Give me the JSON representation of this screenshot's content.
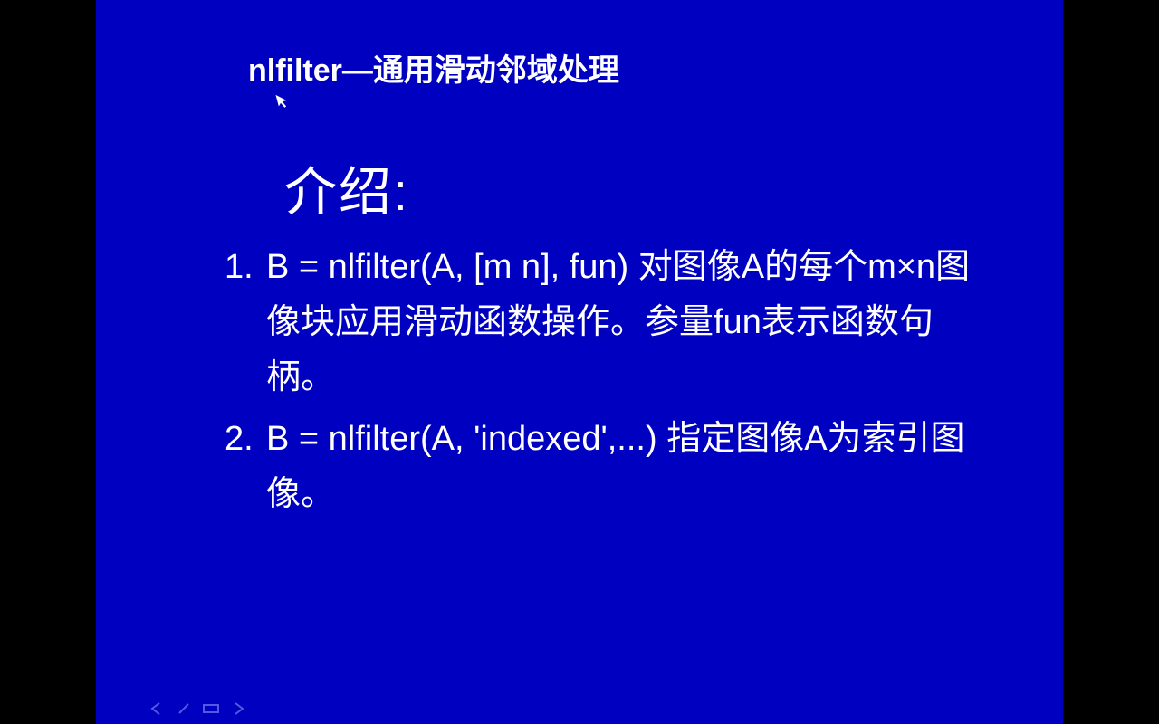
{
  "slide": {
    "title": "nlfilter—通用滑动邻域处理",
    "heading": "介绍:",
    "items": [
      {
        "num": "1.",
        "text": "B = nlfilter(A, [m n], fun)  对图像A的每个m×n图像块应用滑动函数操作。参量fun表示函数句柄。"
      },
      {
        "num": "2.",
        "text": "B = nlfilter(A, 'indexed',...)  指定图像A为索引图像。"
      }
    ]
  },
  "nav": {
    "prev": "previous-slide",
    "pen": "pen-tool",
    "menu": "slide-menu",
    "next": "next-slide"
  }
}
